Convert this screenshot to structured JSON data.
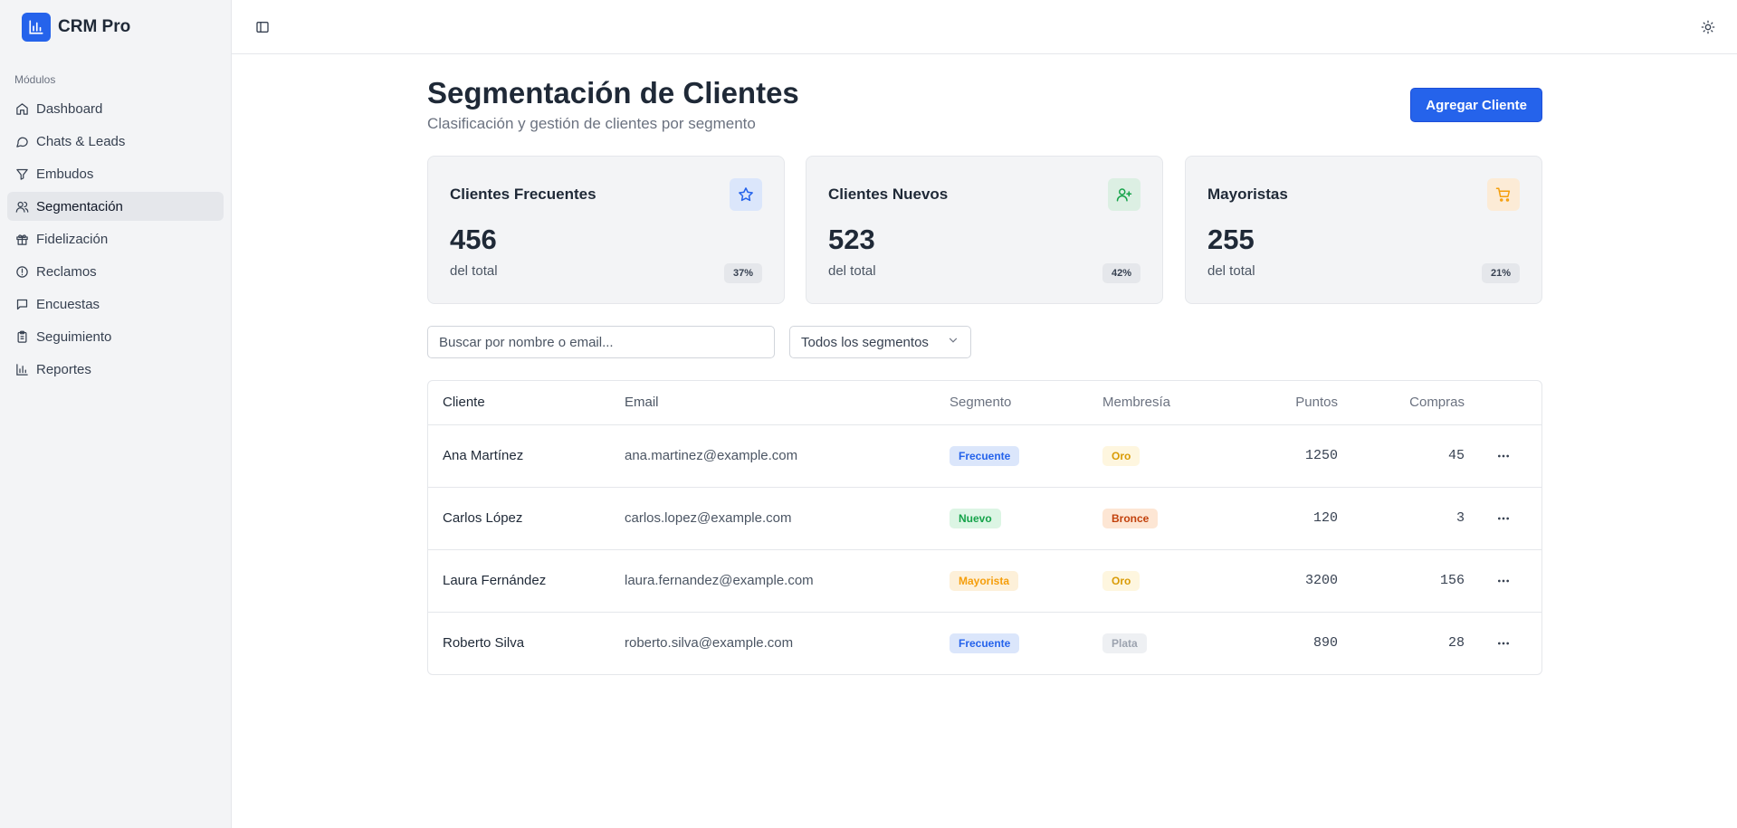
{
  "app": {
    "name": "CRM Pro"
  },
  "sidebar": {
    "section_label": "Módulos",
    "items": [
      {
        "label": "Dashboard",
        "icon": "home-icon"
      },
      {
        "label": "Chats & Leads",
        "icon": "message-icon"
      },
      {
        "label": "Embudos",
        "icon": "filter-icon"
      },
      {
        "label": "Segmentación",
        "icon": "users-icon",
        "active": true
      },
      {
        "label": "Fidelización",
        "icon": "gift-icon"
      },
      {
        "label": "Reclamos",
        "icon": "alert-circle-icon"
      },
      {
        "label": "Encuestas",
        "icon": "message-square-icon"
      },
      {
        "label": "Seguimiento",
        "icon": "clipboard-icon"
      },
      {
        "label": "Reportes",
        "icon": "bar-chart-icon"
      }
    ]
  },
  "page": {
    "title": "Segmentación de Clientes",
    "subtitle": "Clasificación y gestión de clientes por segmento",
    "add_button": "Agregar Cliente"
  },
  "cards": [
    {
      "title": "Clientes Frecuentes",
      "value": "456",
      "foot": "del total",
      "badge": "37%",
      "icon": "star-icon",
      "icon_bg": "#dbe6fb",
      "icon_color": "#2563eb"
    },
    {
      "title": "Clientes Nuevos",
      "value": "523",
      "foot": "del total",
      "badge": "42%",
      "icon": "user-plus-icon",
      "icon_bg": "#dcefe3",
      "icon_color": "#16a34a"
    },
    {
      "title": "Mayoristas",
      "value": "255",
      "foot": "del total",
      "badge": "21%",
      "icon": "cart-icon",
      "icon_bg": "#fcebd6",
      "icon_color": "#f59e0b"
    }
  ],
  "filters": {
    "search_placeholder": "Buscar por nombre o email...",
    "segment_selected": "Todos los segmentos"
  },
  "table": {
    "headers": {
      "cliente": "Cliente",
      "email": "Email",
      "segmento": "Segmento",
      "membresia": "Membresía",
      "puntos": "Puntos",
      "compras": "Compras"
    },
    "rows": [
      {
        "cliente": "Ana Martínez",
        "email": "ana.martinez@example.com",
        "segmento": "Frecuente",
        "membresia": "Oro",
        "puntos": "1250",
        "compras": "45"
      },
      {
        "cliente": "Carlos López",
        "email": "carlos.lopez@example.com",
        "segmento": "Nuevo",
        "membresia": "Bronce",
        "puntos": "120",
        "compras": "3"
      },
      {
        "cliente": "Laura Fernández",
        "email": "laura.fernandez@example.com",
        "segmento": "Mayorista",
        "membresia": "Oro",
        "puntos": "3200",
        "compras": "156"
      },
      {
        "cliente": "Roberto Silva",
        "email": "roberto.silva@example.com",
        "segmento": "Frecuente",
        "membresia": "Plata",
        "puntos": "890",
        "compras": "28"
      }
    ]
  },
  "colors": {
    "accent": "#2563eb",
    "seg_frecuente": {
      "bg": "#dbe6fb",
      "fg": "#2563eb"
    },
    "seg_nuevo": {
      "bg": "#dcf5e4",
      "fg": "#16a34a"
    },
    "seg_mayorista": {
      "bg": "#fdf0d9",
      "fg": "#f59e0b"
    },
    "mem_oro": {
      "bg": "#fef6df",
      "fg": "#d99b06"
    },
    "mem_bronce": {
      "bg": "#fde6d4",
      "fg": "#c2410c"
    },
    "mem_plata": {
      "bg": "#eef0f3",
      "fg": "#9ca3af"
    }
  }
}
